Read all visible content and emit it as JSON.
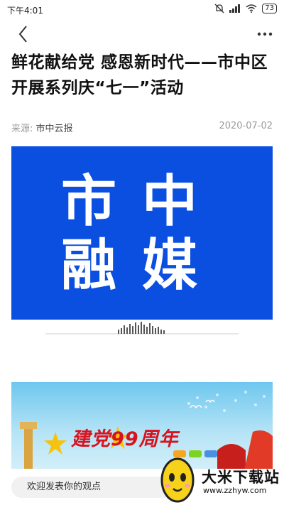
{
  "status_bar": {
    "time": "下午4:01",
    "battery": "73",
    "icons": [
      "mute-icon",
      "signal-icon",
      "wifi-icon",
      "battery-icon"
    ]
  },
  "nav": {
    "back_icon": "chevron-left-icon",
    "more_icon": "more-dots-icon"
  },
  "article": {
    "title": "鲜花献给党 感恩新时代——市中区开展系列庆“七一”活动",
    "source_label": "来源:",
    "source_name": "市中云报",
    "date": "2020-07-02"
  },
  "banner": {
    "line1": "市中",
    "line2": "融媒",
    "background_color": "#0a4fe0"
  },
  "promo_image": {
    "text": "建党99周年",
    "text_color": "#d8121f"
  },
  "comment_bar": {
    "placeholder": "欢迎发表你的观点"
  },
  "watermark": {
    "title": "大米下载站",
    "url": "www.zzhyw.com"
  }
}
